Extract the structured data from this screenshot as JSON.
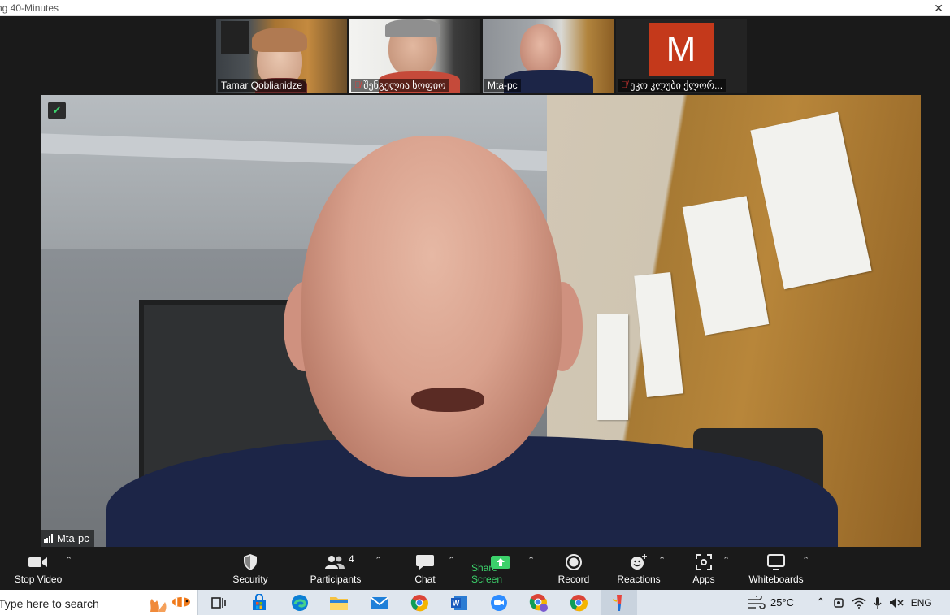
{
  "window": {
    "title": "ng 40-Minutes"
  },
  "thumbnails": [
    {
      "name": "Tamar Qoblianidze",
      "muted": false
    },
    {
      "name": "შენგელია სოფიო",
      "muted": true
    },
    {
      "name": "Mta-pc",
      "muted": false,
      "active": true
    },
    {
      "name": "ეკო კლუბი ქლორ...",
      "muted": true,
      "avatar_letter": "M",
      "avatar_color": "#c4391b"
    }
  ],
  "main_video": {
    "name": "Mta-pc"
  },
  "toolbar": {
    "stop_video": "Stop Video",
    "security": "Security",
    "participants": "Participants",
    "participants_count": "4",
    "chat": "Chat",
    "share_screen": "Share Screen",
    "record": "Record",
    "reactions": "Reactions",
    "apps": "Apps",
    "whiteboards": "Whiteboards",
    "accent_green": "#3cd16b"
  },
  "taskbar": {
    "search_placeholder": "Type here to search",
    "apps": [
      "task-view-icon",
      "store-icon",
      "edge-icon",
      "file-explorer-icon",
      "mail-icon",
      "chrome-icon",
      "word-icon",
      "zoom-icon",
      "chrome-profile-icon",
      "chrome-icon",
      "paint-icon"
    ],
    "weather": "25°C",
    "language": "ENG"
  }
}
